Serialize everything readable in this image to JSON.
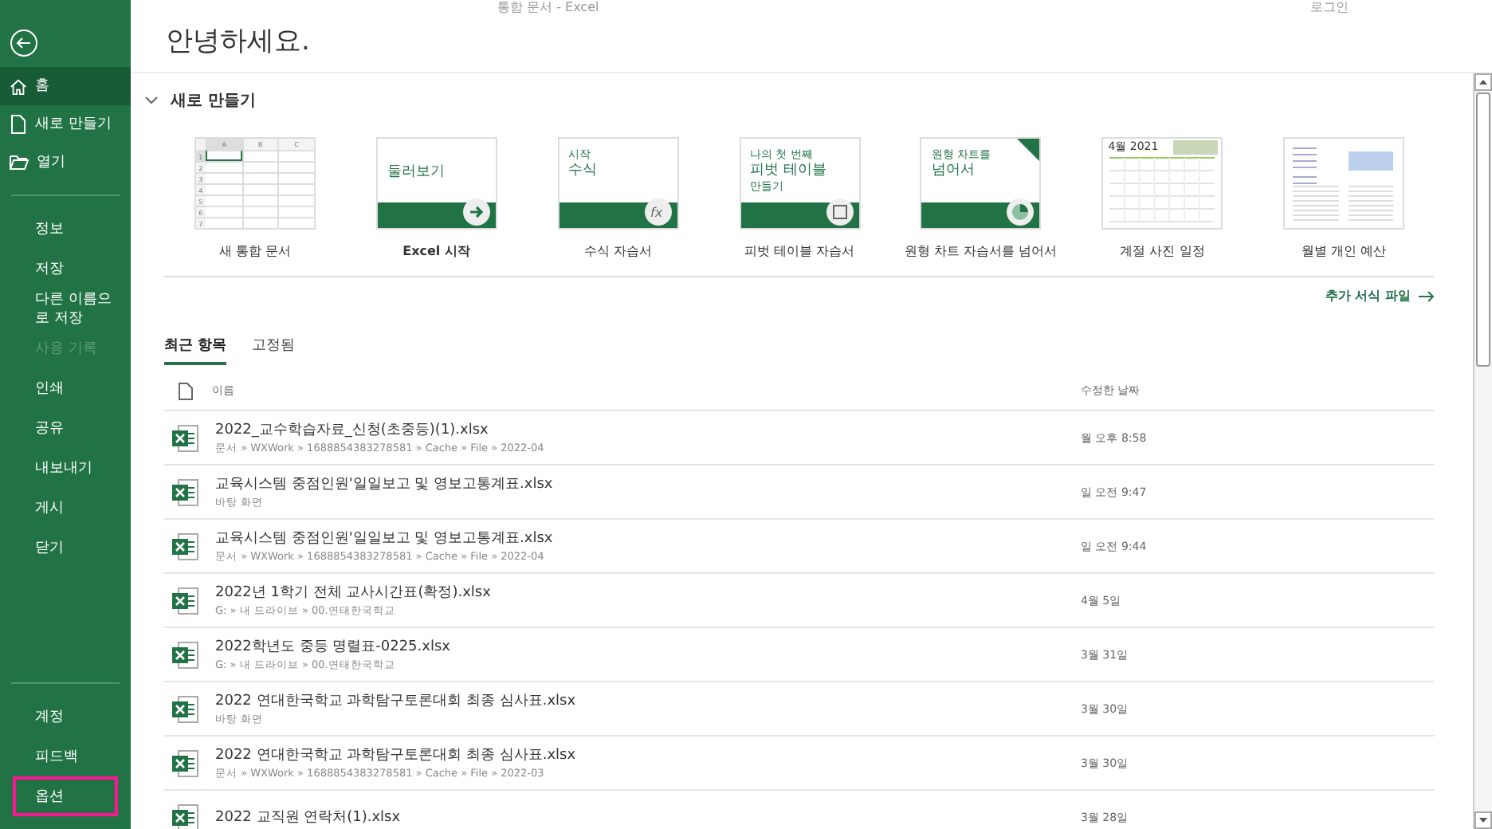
{
  "window": {
    "title": "통합 문서 - Excel",
    "sign_in": "로그인"
  },
  "sidebar": {
    "primary": [
      {
        "label": "홈",
        "selected": true,
        "disabled": false,
        "highlighted": false
      },
      {
        "label": "새로 만들기",
        "selected": false,
        "disabled": false,
        "highlighted": false
      },
      {
        "label": "열기",
        "selected": false,
        "disabled": false,
        "highlighted": false
      }
    ],
    "secondary": [
      {
        "label": "정보",
        "selected": false,
        "disabled": false,
        "highlighted": false
      },
      {
        "label": "저장",
        "selected": false,
        "disabled": false,
        "highlighted": false
      },
      {
        "label": "다른 이름으로 저장",
        "selected": false,
        "disabled": false,
        "highlighted": false
      },
      {
        "label": "사용 기록",
        "selected": false,
        "disabled": true,
        "highlighted": false
      },
      {
        "label": "인쇄",
        "selected": false,
        "disabled": false,
        "highlighted": false
      },
      {
        "label": "공유",
        "selected": false,
        "disabled": false,
        "highlighted": false
      },
      {
        "label": "내보내기",
        "selected": false,
        "disabled": false,
        "highlighted": false
      },
      {
        "label": "게시",
        "selected": false,
        "disabled": false,
        "highlighted": false
      },
      {
        "label": "닫기",
        "selected": false,
        "disabled": false,
        "highlighted": false
      }
    ],
    "footer": [
      {
        "label": "계정",
        "selected": false,
        "disabled": false,
        "highlighted": false
      },
      {
        "label": "피드백",
        "selected": false,
        "disabled": false,
        "highlighted": false
      },
      {
        "label": "옵션",
        "selected": false,
        "disabled": false,
        "highlighted": true
      }
    ]
  },
  "greeting": "안녕하세요.",
  "new_section": {
    "title": "새로 만들기",
    "expanded": true,
    "templates": [
      {
        "kind": "blank",
        "label": "새 통합 문서",
        "thumb_text": [
          "A",
          "B",
          "C",
          "1",
          "2",
          "3",
          "4",
          "5",
          "6",
          "7"
        ]
      },
      {
        "kind": "tour",
        "label": "Excel 시작",
        "thumb_text": [
          "둘러보기"
        ]
      },
      {
        "kind": "formula",
        "label": "수식 자습서",
        "thumb_text": [
          "시작",
          "수식"
        ],
        "icon_text": "fx"
      },
      {
        "kind": "pivot",
        "label": "피벗 테이블 자습서",
        "thumb_text": [
          "나의 첫 번째",
          "피벗 테이블",
          "만들기"
        ]
      },
      {
        "kind": "pie",
        "label": "원형 차트 자습서를 넘어서",
        "thumb_text": [
          "원형 차트를",
          "넘어서"
        ]
      },
      {
        "kind": "calendar",
        "label": "계절 사진 일정",
        "thumb_text": [
          "4월 2021"
        ]
      },
      {
        "kind": "budget",
        "label": "월별 개인 예산"
      }
    ],
    "more_link": "추가 서식 파일"
  },
  "tabs": [
    {
      "label": "최근 항목",
      "selected": true
    },
    {
      "label": "고정됨",
      "selected": false
    }
  ],
  "recent": {
    "columns": [
      "이름",
      "수정한 날짜"
    ],
    "rows": [
      {
        "name": "2022_교수학습자료_신청(초중등)(1).xlsx",
        "path": "문서 » WXWork » 1688854383278581 » Cache » File » 2022-04",
        "date": "월 오후 8:58"
      },
      {
        "name": "교육시스템 중점인원'일일보고 및 영보고통계표.xlsx",
        "path": "바탕 화면",
        "date": "일 오전 9:47"
      },
      {
        "name": "교육시스템 중점인원'일일보고 및 영보고통계표.xlsx",
        "path": "문서 » WXWork » 1688854383278581 » Cache » File » 2022-04",
        "date": "일 오전 9:44"
      },
      {
        "name": "2022년 1학기 전체 교사시간표(확정).xlsx",
        "path": "G: » 내 드라이브 » 00.연태한국학교",
        "date": "4월 5일"
      },
      {
        "name": "2022학년도 중등 명렬표-0225.xlsx",
        "path": "G: » 내 드라이브 » 00.연태한국학교",
        "date": "3월 31일"
      },
      {
        "name": "2022 연대한국학교 과학탐구토론대회 최종 심사표.xlsx",
        "path": "바탕 화면",
        "date": "3월 30일"
      },
      {
        "name": "2022 연대한국학교 과학탐구토론대회 최종 심사표.xlsx",
        "path": "문서 » WXWork » 1688854383278581 » Cache » File » 2022-03",
        "date": "3월 30일"
      },
      {
        "name": "2022 교직원 연락처(1).xlsx",
        "date": "3월 28일"
      }
    ]
  }
}
